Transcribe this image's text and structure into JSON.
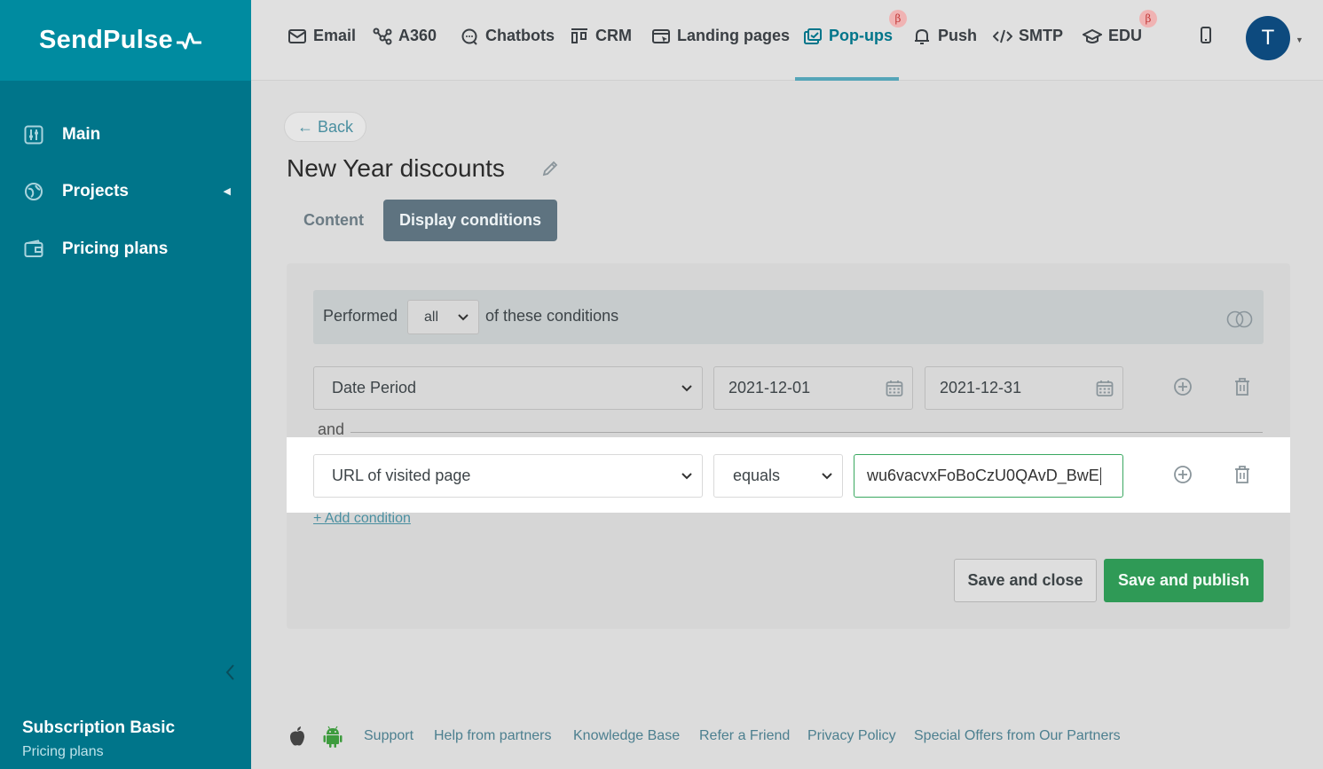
{
  "brand": {
    "name": "SendPulse"
  },
  "sidebar": {
    "items": [
      {
        "label": "Main",
        "icon": "dashboard-icon"
      },
      {
        "label": "Projects",
        "icon": "globe-icon"
      },
      {
        "label": "Pricing plans",
        "icon": "wallet-icon"
      }
    ],
    "subscription_title": "Subscription Basic",
    "subscription_link": "Pricing plans"
  },
  "topnav": {
    "items": [
      {
        "label": "Email",
        "icon": "mail-icon"
      },
      {
        "label": "A360",
        "icon": "nodes-icon"
      },
      {
        "label": "Chatbots",
        "icon": "chat-icon"
      },
      {
        "label": "CRM",
        "icon": "kanban-icon"
      },
      {
        "label": "Landing pages",
        "icon": "landing-icon"
      },
      {
        "label": "Pop-ups",
        "icon": "popup-icon",
        "active": true,
        "beta": "β"
      },
      {
        "label": "Push",
        "icon": "bell-icon"
      },
      {
        "label": "SMTP",
        "icon": "code-icon"
      },
      {
        "label": "EDU",
        "icon": "graduation-cap-icon",
        "beta": "β"
      }
    ],
    "avatar_letter": "T"
  },
  "page": {
    "back_label": "← Back",
    "title": "New Year discounts",
    "tabs": [
      {
        "label": "Content"
      },
      {
        "label": "Display conditions",
        "active": true
      }
    ]
  },
  "conditions": {
    "performed_label": "Performed",
    "match_value": "all",
    "suffix_label": "of these conditions",
    "row1": {
      "field": "Date Period",
      "date_from": "2021-12-01",
      "date_to": "2021-12-31"
    },
    "joiner": "and",
    "row2": {
      "field": "URL of visited page",
      "operator": "equals",
      "value": "wu6vacvxFoBoCzU0QAvD_BwE"
    },
    "add_label": "+ Add condition"
  },
  "actions": {
    "save_close": "Save and close",
    "save_publish": "Save and publish"
  },
  "footer": {
    "links": [
      "Support",
      "Help from partners",
      "Knowledge Base",
      "Refer a Friend",
      "Privacy Policy",
      "Special Offers from Our Partners"
    ]
  },
  "colors": {
    "sidebar": "#00758a",
    "accent": "#00758a",
    "publish": "#2f9a56",
    "beta_badge": "#f0b3b3"
  }
}
